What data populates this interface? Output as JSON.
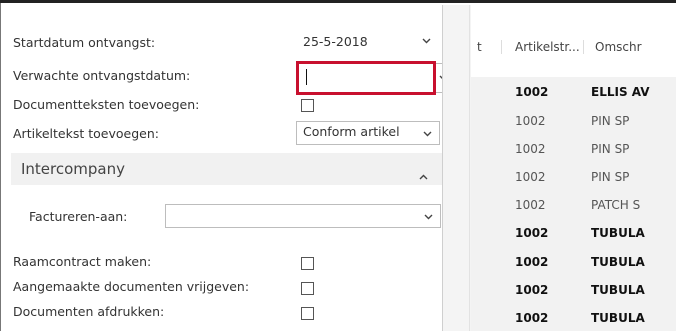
{
  "form": {
    "start_date_label": "Startdatum ontvangst:",
    "start_date_value": "25-5-2018",
    "expected_date_label": "Verwachte ontvangstdatum:",
    "expected_date_value": "",
    "doc_texts_label": "Documentteksten toevoegen:",
    "item_text_label": "Artikeltekst toevoegen:",
    "item_text_value": "Conform artikel",
    "section_title": "Intercompany",
    "invoice_to_label": "Factureren-aan:",
    "invoice_to_value": "",
    "frame_contract_label": "Raamcontract maken:",
    "release_docs_label": "Aangemaakte documenten vrijgeven:",
    "print_docs_label": "Documenten afdrukken:"
  },
  "grid": {
    "col_partial": "t",
    "col_item": "Artikelstr...",
    "col_desc": "Omschr",
    "rows": [
      {
        "item": "1002",
        "desc": "ELLIS AV",
        "bold": true
      },
      {
        "item": "1002",
        "desc": "PIN SP",
        "bold": false
      },
      {
        "item": "1002",
        "desc": "PIN SP",
        "bold": false
      },
      {
        "item": "1002",
        "desc": "PIN SP",
        "bold": false
      },
      {
        "item": "1002",
        "desc": "PATCH S",
        "bold": false
      },
      {
        "item": "1002",
        "desc": "TUBULA",
        "bold": true
      },
      {
        "item": "1002",
        "desc": "TUBULA",
        "bold": true
      },
      {
        "item": "1002",
        "desc": "TUBULA",
        "bold": true
      },
      {
        "item": "1002",
        "desc": "TUBULA",
        "bold": true
      }
    ]
  },
  "colors": {
    "focus_border": "#c8102e",
    "section_bg": "#f1f1f1",
    "grid_bg": "#f2f2f2"
  }
}
